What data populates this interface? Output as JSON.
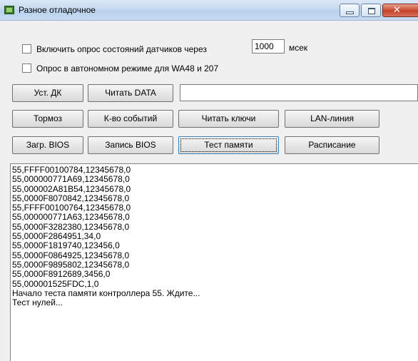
{
  "window": {
    "title": "Разное отладочное"
  },
  "options": {
    "poll_sensors_label": "Включить опрос состояний датчиков через",
    "poll_interval_value": "1000",
    "poll_interval_unit": "мсек",
    "autonomous_label": "Опрос в автономном режиме для WA48 и 207",
    "poll_sensors_checked": false,
    "autonomous_checked": false
  },
  "buttons": {
    "set_dk": "Уст. ДК",
    "read_data": "Читать DATA",
    "brake": "Тормоз",
    "event_count": "К-во событий",
    "read_keys": "Читать ключи",
    "lan_line": "LAN-линия",
    "load_bios": "Загр. BIOS",
    "write_bios": "Запись BIOS",
    "memory_test": "Тест памяти",
    "schedule": "Расписание"
  },
  "data_field": {
    "value": ""
  },
  "log": [
    "55,FFFF00100784,12345678,0",
    "55,000000771A69,12345678,0",
    "55,000002A81B54,12345678,0",
    "55,0000F8070842,12345678,0",
    "55,FFFF00100764,12345678,0",
    "55,000000771A63,12345678,0",
    "55,0000F3282380,12345678,0",
    "55,0000F2864951,34,0",
    "55,0000F1819740,123456,0",
    "55,0000F0864925,12345678,0",
    "55,0000F9895802,12345678,0",
    "55,0000F8912689,3456,0",
    "55,000001525FDC,1,0",
    "Начало теста памяти контроллера 55. Ждите...",
    "Тест нулей..."
  ]
}
